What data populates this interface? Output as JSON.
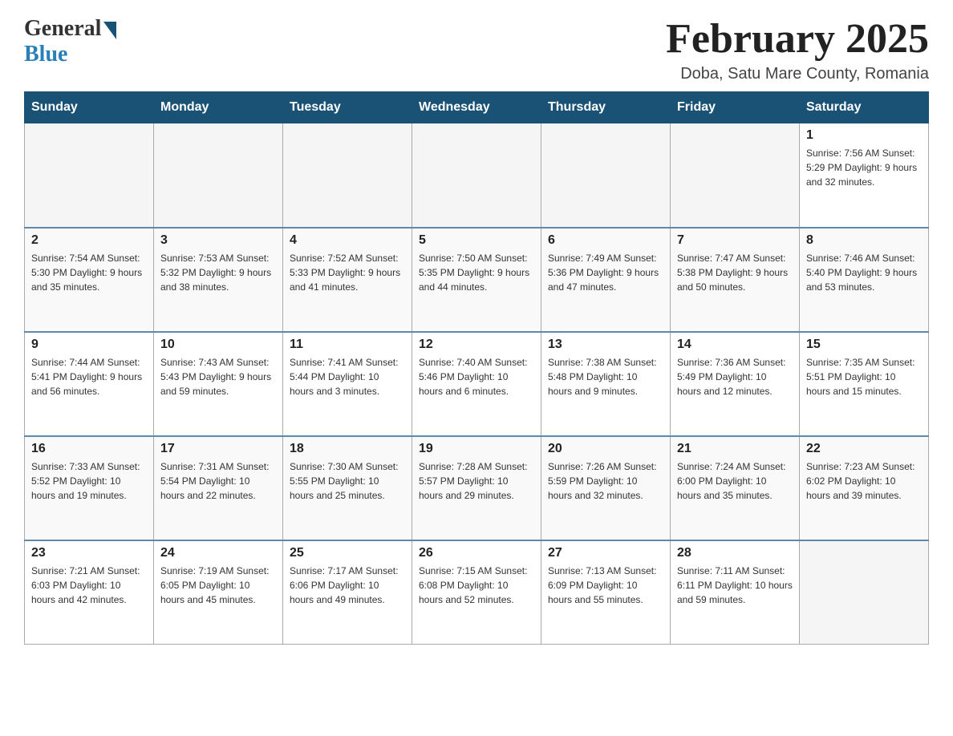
{
  "logo": {
    "general": "General",
    "blue": "Blue"
  },
  "title": "February 2025",
  "location": "Doba, Satu Mare County, Romania",
  "days_of_week": [
    "Sunday",
    "Monday",
    "Tuesday",
    "Wednesday",
    "Thursday",
    "Friday",
    "Saturday"
  ],
  "weeks": [
    [
      {
        "day": "",
        "info": ""
      },
      {
        "day": "",
        "info": ""
      },
      {
        "day": "",
        "info": ""
      },
      {
        "day": "",
        "info": ""
      },
      {
        "day": "",
        "info": ""
      },
      {
        "day": "",
        "info": ""
      },
      {
        "day": "1",
        "info": "Sunrise: 7:56 AM\nSunset: 5:29 PM\nDaylight: 9 hours\nand 32 minutes."
      }
    ],
    [
      {
        "day": "2",
        "info": "Sunrise: 7:54 AM\nSunset: 5:30 PM\nDaylight: 9 hours\nand 35 minutes."
      },
      {
        "day": "3",
        "info": "Sunrise: 7:53 AM\nSunset: 5:32 PM\nDaylight: 9 hours\nand 38 minutes."
      },
      {
        "day": "4",
        "info": "Sunrise: 7:52 AM\nSunset: 5:33 PM\nDaylight: 9 hours\nand 41 minutes."
      },
      {
        "day": "5",
        "info": "Sunrise: 7:50 AM\nSunset: 5:35 PM\nDaylight: 9 hours\nand 44 minutes."
      },
      {
        "day": "6",
        "info": "Sunrise: 7:49 AM\nSunset: 5:36 PM\nDaylight: 9 hours\nand 47 minutes."
      },
      {
        "day": "7",
        "info": "Sunrise: 7:47 AM\nSunset: 5:38 PM\nDaylight: 9 hours\nand 50 minutes."
      },
      {
        "day": "8",
        "info": "Sunrise: 7:46 AM\nSunset: 5:40 PM\nDaylight: 9 hours\nand 53 minutes."
      }
    ],
    [
      {
        "day": "9",
        "info": "Sunrise: 7:44 AM\nSunset: 5:41 PM\nDaylight: 9 hours\nand 56 minutes."
      },
      {
        "day": "10",
        "info": "Sunrise: 7:43 AM\nSunset: 5:43 PM\nDaylight: 9 hours\nand 59 minutes."
      },
      {
        "day": "11",
        "info": "Sunrise: 7:41 AM\nSunset: 5:44 PM\nDaylight: 10 hours\nand 3 minutes."
      },
      {
        "day": "12",
        "info": "Sunrise: 7:40 AM\nSunset: 5:46 PM\nDaylight: 10 hours\nand 6 minutes."
      },
      {
        "day": "13",
        "info": "Sunrise: 7:38 AM\nSunset: 5:48 PM\nDaylight: 10 hours\nand 9 minutes."
      },
      {
        "day": "14",
        "info": "Sunrise: 7:36 AM\nSunset: 5:49 PM\nDaylight: 10 hours\nand 12 minutes."
      },
      {
        "day": "15",
        "info": "Sunrise: 7:35 AM\nSunset: 5:51 PM\nDaylight: 10 hours\nand 15 minutes."
      }
    ],
    [
      {
        "day": "16",
        "info": "Sunrise: 7:33 AM\nSunset: 5:52 PM\nDaylight: 10 hours\nand 19 minutes."
      },
      {
        "day": "17",
        "info": "Sunrise: 7:31 AM\nSunset: 5:54 PM\nDaylight: 10 hours\nand 22 minutes."
      },
      {
        "day": "18",
        "info": "Sunrise: 7:30 AM\nSunset: 5:55 PM\nDaylight: 10 hours\nand 25 minutes."
      },
      {
        "day": "19",
        "info": "Sunrise: 7:28 AM\nSunset: 5:57 PM\nDaylight: 10 hours\nand 29 minutes."
      },
      {
        "day": "20",
        "info": "Sunrise: 7:26 AM\nSunset: 5:59 PM\nDaylight: 10 hours\nand 32 minutes."
      },
      {
        "day": "21",
        "info": "Sunrise: 7:24 AM\nSunset: 6:00 PM\nDaylight: 10 hours\nand 35 minutes."
      },
      {
        "day": "22",
        "info": "Sunrise: 7:23 AM\nSunset: 6:02 PM\nDaylight: 10 hours\nand 39 minutes."
      }
    ],
    [
      {
        "day": "23",
        "info": "Sunrise: 7:21 AM\nSunset: 6:03 PM\nDaylight: 10 hours\nand 42 minutes."
      },
      {
        "day": "24",
        "info": "Sunrise: 7:19 AM\nSunset: 6:05 PM\nDaylight: 10 hours\nand 45 minutes."
      },
      {
        "day": "25",
        "info": "Sunrise: 7:17 AM\nSunset: 6:06 PM\nDaylight: 10 hours\nand 49 minutes."
      },
      {
        "day": "26",
        "info": "Sunrise: 7:15 AM\nSunset: 6:08 PM\nDaylight: 10 hours\nand 52 minutes."
      },
      {
        "day": "27",
        "info": "Sunrise: 7:13 AM\nSunset: 6:09 PM\nDaylight: 10 hours\nand 55 minutes."
      },
      {
        "day": "28",
        "info": "Sunrise: 7:11 AM\nSunset: 6:11 PM\nDaylight: 10 hours\nand 59 minutes."
      },
      {
        "day": "",
        "info": ""
      }
    ]
  ]
}
